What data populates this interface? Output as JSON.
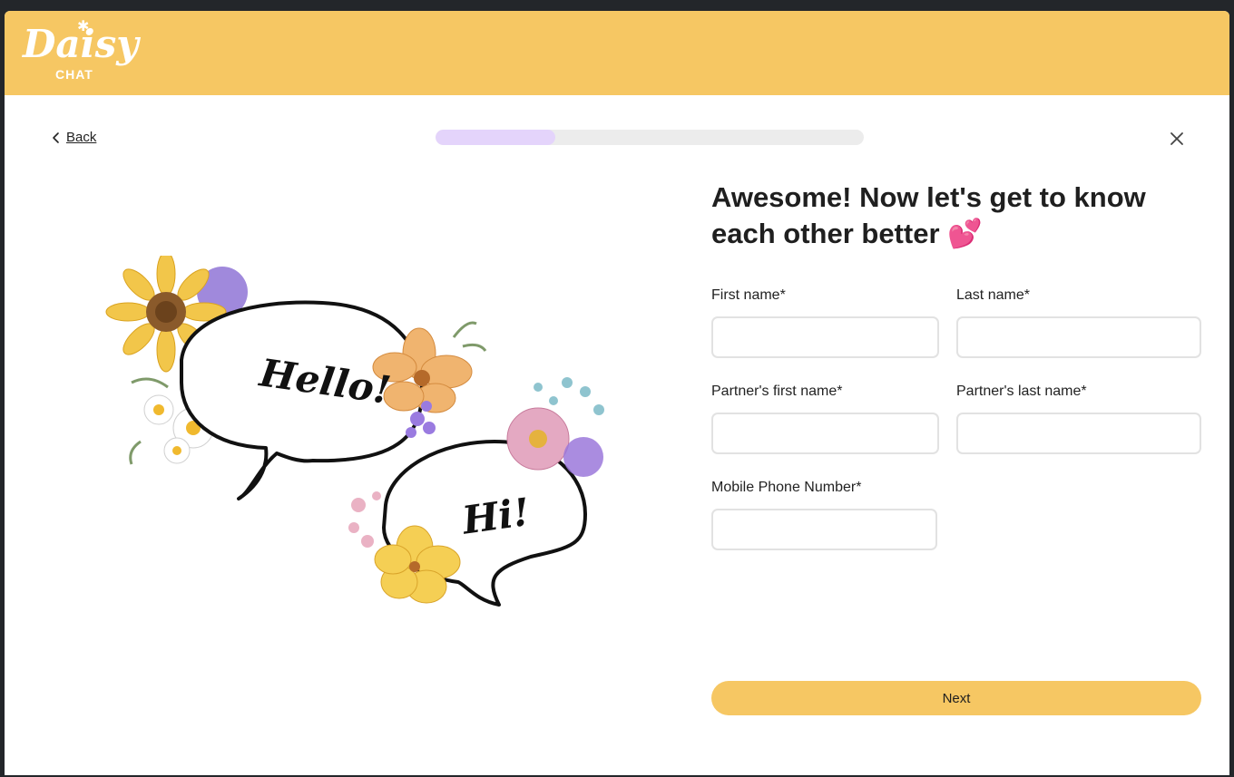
{
  "brand": {
    "name": "Daisy",
    "sub": "CHAT"
  },
  "nav": {
    "back_label": "Back",
    "progress": 0.28
  },
  "headline": {
    "text": "Awesome! Now let's get to know each other better",
    "emoji": "💕"
  },
  "illustration": {
    "bubble_left": "Hello!",
    "bubble_right": "Hi!"
  },
  "form": {
    "first_name": {
      "label": "First name*",
      "value": ""
    },
    "last_name": {
      "label": "Last name*",
      "value": ""
    },
    "partner_first_name": {
      "label": "Partner's first name*",
      "value": ""
    },
    "partner_last_name": {
      "label": "Partner's last name*",
      "value": ""
    },
    "phone": {
      "label": "Mobile Phone Number*",
      "value": ""
    }
  },
  "actions": {
    "next_label": "Next"
  },
  "colors": {
    "brand_yellow": "#f6c763",
    "progress_fill": "#e4d4fb",
    "progress_track": "#ececec"
  },
  "icons": {
    "back": "chevron-left-icon",
    "close": "close-icon",
    "headline": "two-hearts-emoji"
  }
}
